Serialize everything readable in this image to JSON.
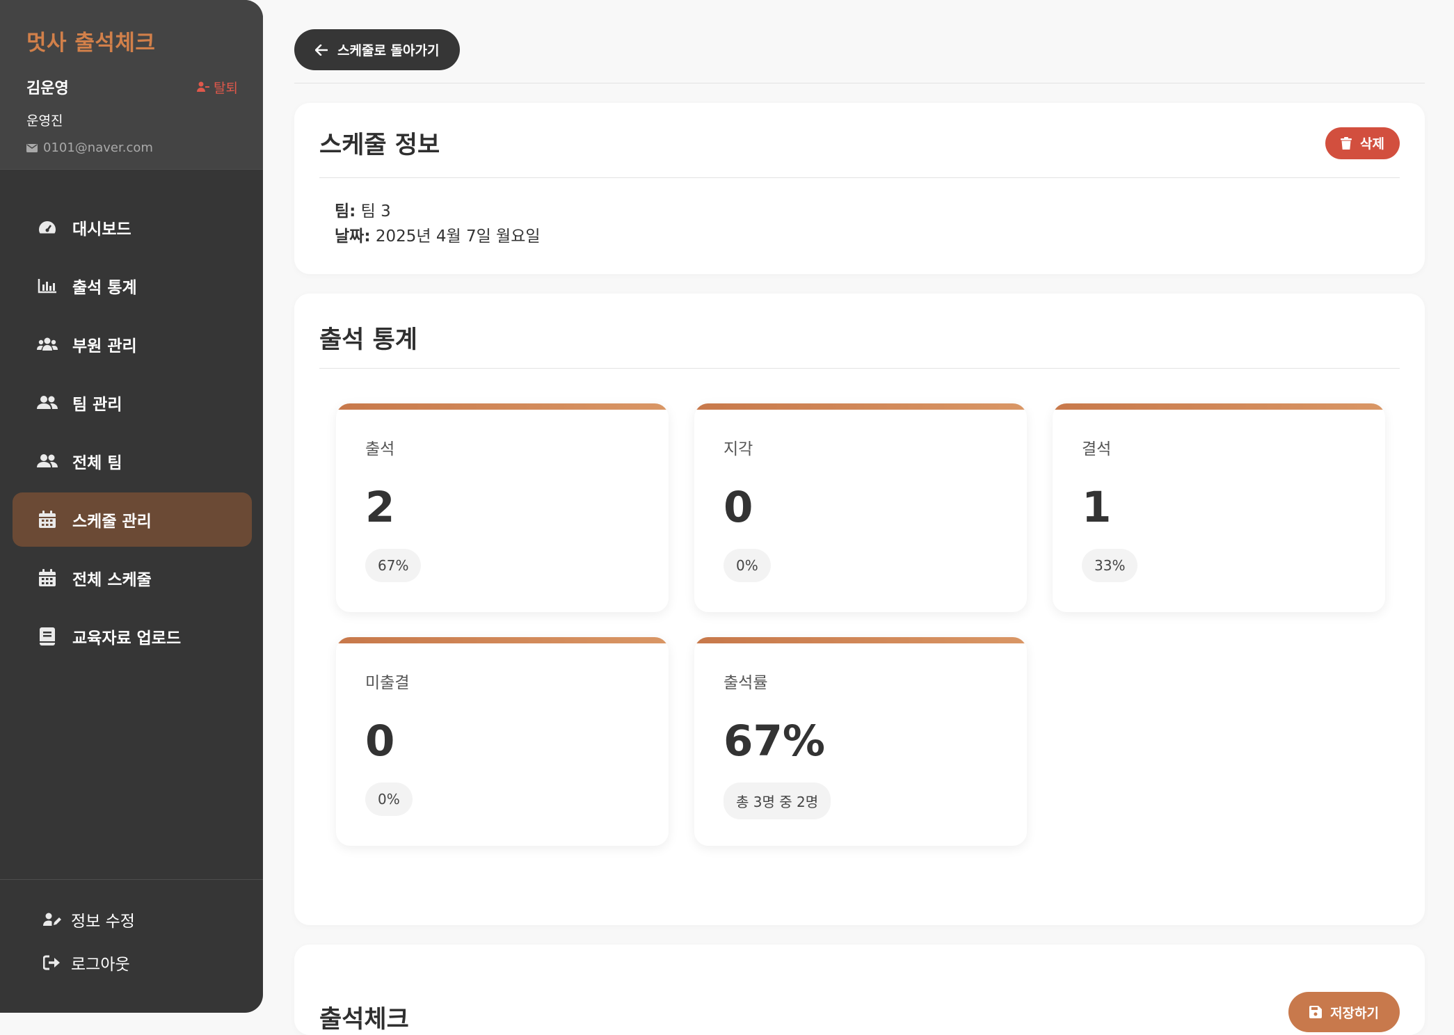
{
  "sidebar": {
    "brand": "멋사 출석체크",
    "user_name": "김운영",
    "withdraw_label": "탈퇴",
    "role": "운영진",
    "email": "0101@naver.com",
    "nav": [
      {
        "label": "대시보드",
        "icon": "dashboard-icon"
      },
      {
        "label": "출석 통계",
        "icon": "chart-bar-icon"
      },
      {
        "label": "부원 관리",
        "icon": "users-icon"
      },
      {
        "label": "팀 관리",
        "icon": "user-group-icon"
      },
      {
        "label": "전체 팀",
        "icon": "user-group-icon"
      },
      {
        "label": "스케줄 관리",
        "icon": "calendar-icon",
        "active": true
      },
      {
        "label": "전체 스케줄",
        "icon": "calendar-icon"
      },
      {
        "label": "교육자료 업로드",
        "icon": "book-icon"
      }
    ],
    "bottom": {
      "edit_info": "정보 수정",
      "logout": "로그아웃"
    }
  },
  "main": {
    "back_label": "스케줄로 돌아가기",
    "schedule_info": {
      "title": "스케줄 정보",
      "delete_label": "삭제",
      "team_label": "팀:",
      "team_value": "팀 3",
      "date_label": "날짜:",
      "date_value": "2025년 4월 7일 월요일"
    },
    "stats": {
      "title": "출석 통계",
      "cards": [
        {
          "label": "출석",
          "value": "2",
          "pill": "67%"
        },
        {
          "label": "지각",
          "value": "0",
          "pill": "0%"
        },
        {
          "label": "결석",
          "value": "1",
          "pill": "33%"
        },
        {
          "label": "미출결",
          "value": "0",
          "pill": "0%"
        },
        {
          "label": "출석률",
          "value": "67%",
          "pill": "총 3명 중 2명"
        }
      ]
    },
    "check": {
      "title": "출석체크",
      "save_label": "저장하기"
    }
  },
  "colors": {
    "accent": "#c8794c",
    "sidebar_bg": "#363636",
    "active_nav": "#6b4a35",
    "danger": "#d24f3e"
  }
}
